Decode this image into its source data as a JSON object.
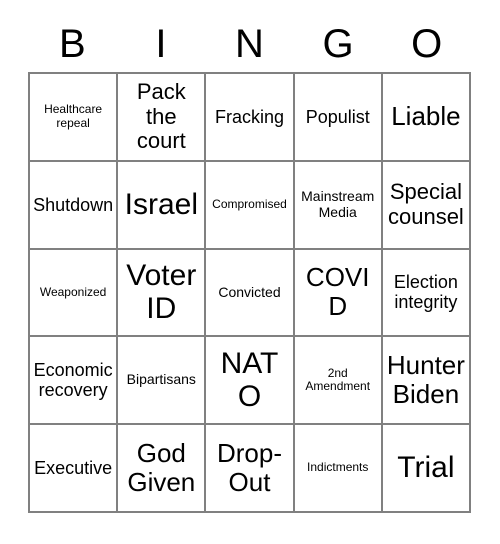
{
  "card": {
    "title": "BINGO Card",
    "header_letters": [
      "B",
      "I",
      "N",
      "G",
      "O"
    ],
    "grid_size": "5x5",
    "colors": {
      "background": "#ffffff",
      "text": "#000000",
      "grid_line": "#808080"
    },
    "rows": [
      [
        {
          "text": "Healthcare repeal",
          "size": "xs"
        },
        {
          "text": "Pack the court",
          "size": "lg"
        },
        {
          "text": "Fracking",
          "size": "md"
        },
        {
          "text": "Populist",
          "size": "md"
        },
        {
          "text": "Liable",
          "size": "xl"
        }
      ],
      [
        {
          "text": "Shutdown",
          "size": "md"
        },
        {
          "text": "Israel",
          "size": "xxl"
        },
        {
          "text": "Compromised",
          "size": "xs"
        },
        {
          "text": "Mainstream Media",
          "size": "sm"
        },
        {
          "text": "Special counsel",
          "size": "lg"
        }
      ],
      [
        {
          "text": "Weaponized",
          "size": "xs"
        },
        {
          "text": "Voter ID",
          "size": "xxl"
        },
        {
          "text": "Convicted",
          "size": "sm"
        },
        {
          "text": "COVID",
          "size": "xl"
        },
        {
          "text": "Election integrity",
          "size": "md"
        }
      ],
      [
        {
          "text": "Economic recovery",
          "size": "md"
        },
        {
          "text": "Bipartisans",
          "size": "sm"
        },
        {
          "text": "NATO",
          "size": "xxl"
        },
        {
          "text": "2nd Amendment",
          "size": "xs"
        },
        {
          "text": "Hunter Biden",
          "size": "xl"
        }
      ],
      [
        {
          "text": "Executive",
          "size": "md"
        },
        {
          "text": "God Given",
          "size": "xl"
        },
        {
          "text": "Drop-Out",
          "size": "xl"
        },
        {
          "text": "Indictments",
          "size": "xs"
        },
        {
          "text": "Trial",
          "size": "xxl"
        }
      ]
    ]
  }
}
